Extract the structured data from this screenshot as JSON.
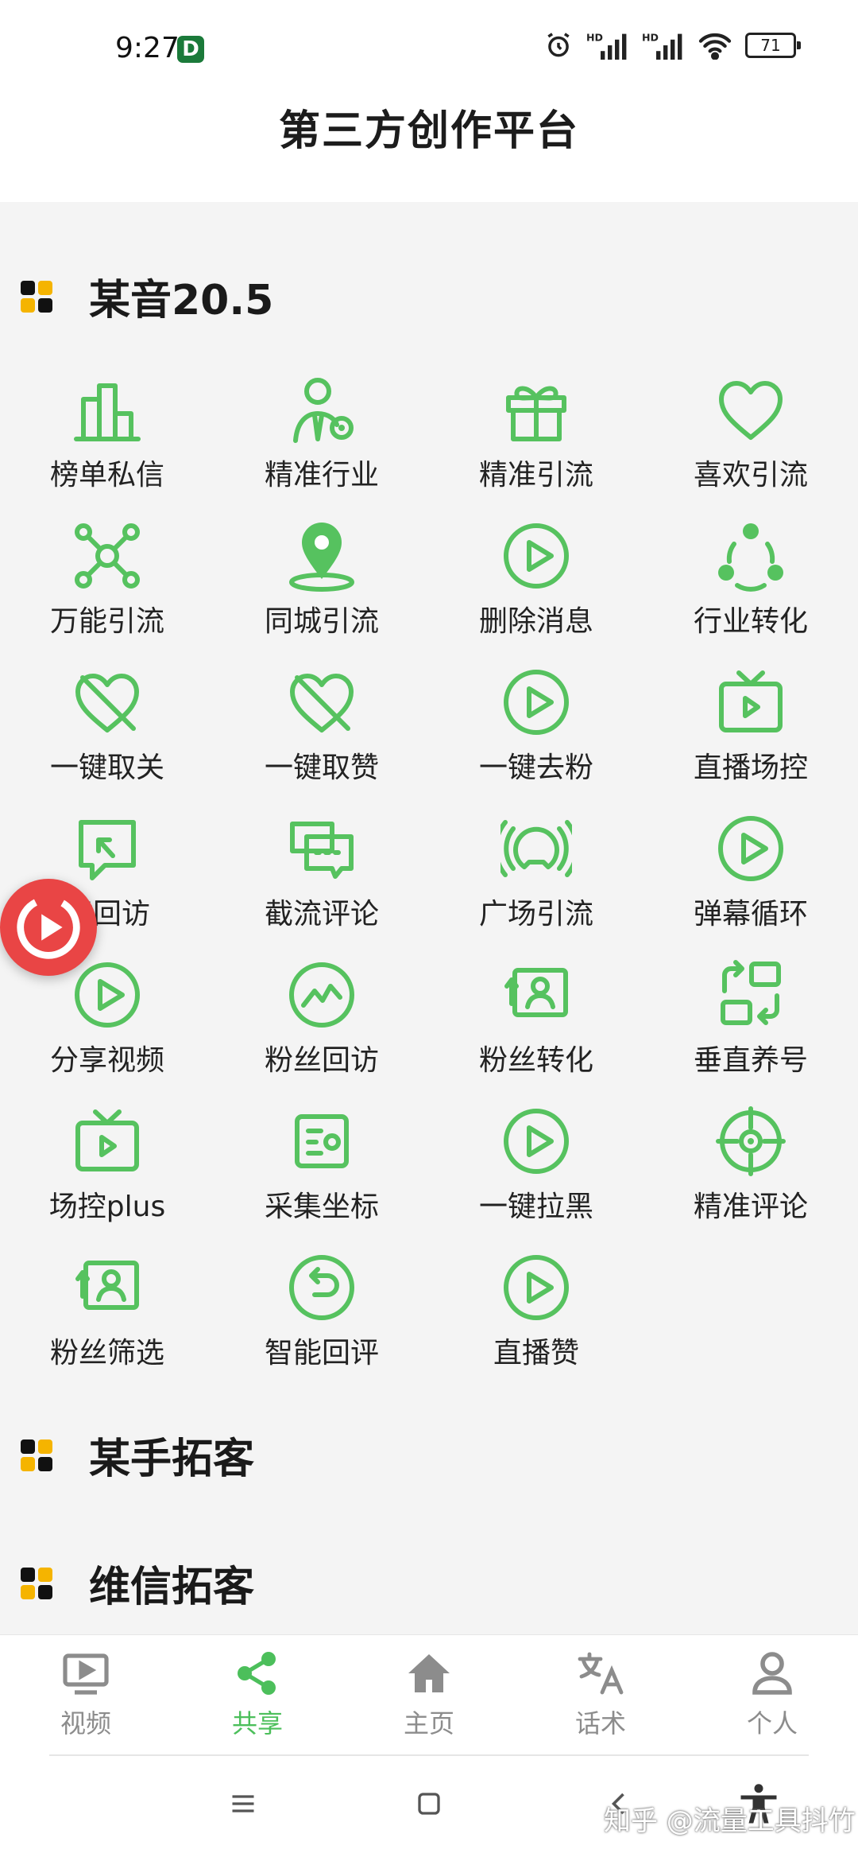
{
  "status_bar": {
    "time": "9:27",
    "badge": "D",
    "battery": "71"
  },
  "page": {
    "title": "第三方创作平台"
  },
  "sections": [
    {
      "title": "某音20.5"
    },
    {
      "title": "某手拓客"
    },
    {
      "title": "维信拓客"
    }
  ],
  "grid_items": [
    {
      "label": "榜单私信",
      "icon": "bar-chart-icon"
    },
    {
      "label": "精准行业",
      "icon": "person-target-icon"
    },
    {
      "label": "精准引流",
      "icon": "gift-icon"
    },
    {
      "label": "喜欢引流",
      "icon": "heart-icon"
    },
    {
      "label": "万能引流",
      "icon": "hub-icon"
    },
    {
      "label": "同城引流",
      "icon": "location-pin-icon"
    },
    {
      "label": "删除消息",
      "icon": "play-circle-icon"
    },
    {
      "label": "行业转化",
      "icon": "share-cycle-icon"
    },
    {
      "label": "一键取关",
      "icon": "heart-off-icon"
    },
    {
      "label": "一键取赞",
      "icon": "heart-off-icon"
    },
    {
      "label": "一键去粉",
      "icon": "play-circle-icon"
    },
    {
      "label": "直播场控",
      "icon": "tv-icon"
    },
    {
      "label": "键回访",
      "icon": "chat-return-icon"
    },
    {
      "label": "截流评论",
      "icon": "chat-bubbles-icon"
    },
    {
      "label": "广场引流",
      "icon": "broadcast-icon"
    },
    {
      "label": "弹幕循环",
      "icon": "play-circle-icon"
    },
    {
      "label": "分享视频",
      "icon": "play-circle-icon"
    },
    {
      "label": "粉丝回访",
      "icon": "trend-circle-icon"
    },
    {
      "label": "粉丝转化",
      "icon": "profile-card-icon"
    },
    {
      "label": "垂直养号",
      "icon": "swap-squares-icon"
    },
    {
      "label": "场控plus",
      "icon": "tv-icon"
    },
    {
      "label": "采集坐标",
      "icon": "card-list-icon"
    },
    {
      "label": "一键拉黑",
      "icon": "play-circle-icon"
    },
    {
      "label": "精准评论",
      "icon": "crosshair-icon"
    },
    {
      "label": "粉丝筛选",
      "icon": "profile-card-icon"
    },
    {
      "label": "智能回评",
      "icon": "undo-circle-icon"
    },
    {
      "label": "直播赞",
      "icon": "play-circle-icon"
    }
  ],
  "bottom_nav": [
    {
      "label": "视频",
      "icon": "video-icon",
      "active": false
    },
    {
      "label": "共享",
      "icon": "share-icon",
      "active": true
    },
    {
      "label": "主页",
      "icon": "home-icon",
      "active": false
    },
    {
      "label": "话术",
      "icon": "translate-icon",
      "active": false
    },
    {
      "label": "个人",
      "icon": "person-icon",
      "active": false
    }
  ],
  "colors": {
    "accent": "#4cbf5b",
    "icon_green": "#56c25f",
    "float_red": "#e94545",
    "nav_gray": "#8c8c8c"
  },
  "watermark": "知乎 @流量工具抖竹"
}
